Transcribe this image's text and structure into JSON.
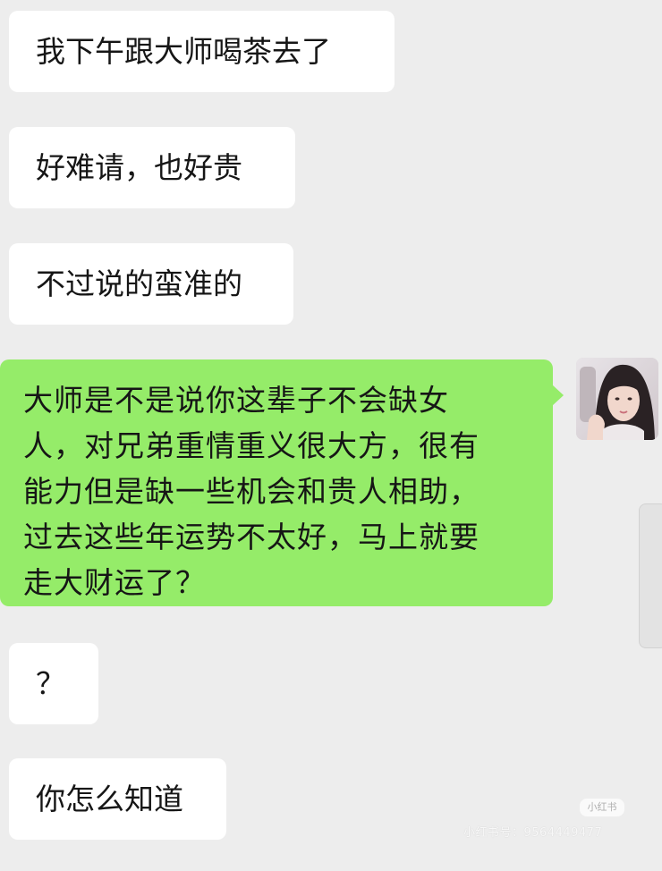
{
  "messages": [
    {
      "side": "received",
      "text": "我下午跟大师喝茶去了"
    },
    {
      "side": "received",
      "text": "好难请，也好贵"
    },
    {
      "side": "received",
      "text": "不过说的蛮准的"
    },
    {
      "side": "sent",
      "lines": [
        "大师是不是说你这辈子不会缺女",
        "人，对兄弟重情重义很大方，很有",
        "能力但是缺一些机会和贵人相助，",
        "过去这些年运势不太好，马上就要",
        "走大财运了？"
      ]
    },
    {
      "side": "received",
      "text": "？"
    },
    {
      "side": "received",
      "text": "你怎么知道"
    }
  ],
  "avatar": {
    "icon": "user-avatar-photo"
  },
  "watermark": {
    "logo": "小红书",
    "text": "小红书号：9564449477"
  },
  "colors": {
    "background": "#ededed",
    "received_bubble": "#ffffff",
    "sent_bubble": "#95ec69",
    "text": "#161616"
  }
}
